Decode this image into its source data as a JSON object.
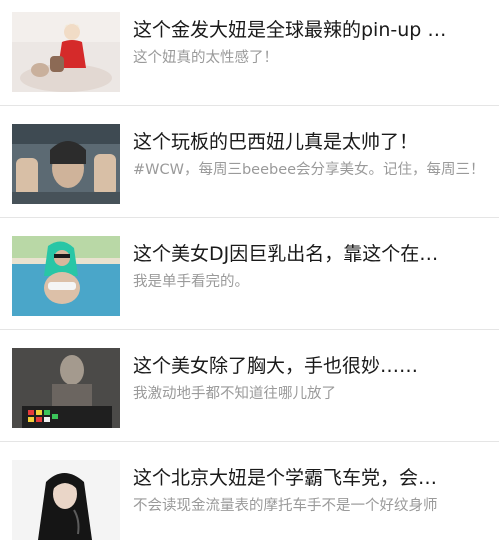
{
  "articles": [
    {
      "title": "这个金发大妞是全球最辣的pin-up …",
      "description": "这个妞真的太性感了！",
      "thumbnail": "pinup-photo"
    },
    {
      "title": "这个玩板的巴西妞儿真是太帅了！",
      "description": "#WCW，每周三beebee会分享美女。记住，每周三！",
      "thumbnail": "skater-photo"
    },
    {
      "title": "这个美女DJ因巨乳出名，靠这个在…",
      "description": "我是单手看完的。",
      "thumbnail": "pool-photo"
    },
    {
      "title": "这个美女除了胸大，手也很妙……",
      "description": "我激动地手都不知道往哪儿放了",
      "thumbnail": "dj-photo"
    },
    {
      "title": "这个北京大妞是个学霸飞车党，会…",
      "description": "不会读现金流量表的摩托车手不是一个好纹身师",
      "thumbnail": "biker-photo"
    }
  ]
}
